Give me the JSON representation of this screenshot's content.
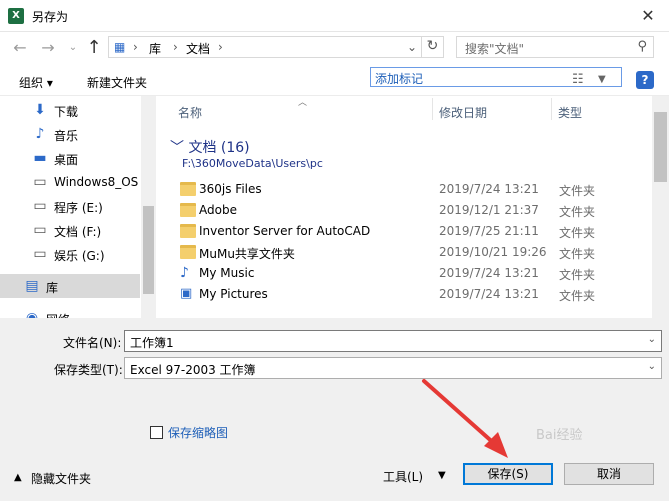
{
  "window": {
    "title": "另存为",
    "app_icon": "X",
    "close_icon": "✕"
  },
  "address": {
    "root_icon": "▦",
    "crumbs": [
      "库",
      "文档"
    ],
    "separator": "›"
  },
  "search": {
    "placeholder": "搜索\"文档\""
  },
  "toolbar": {
    "organize_label": "组织 ▾",
    "new_folder_label": "新建文件夹",
    "add_tag_label": "添加标记"
  },
  "sidebar": {
    "items": [
      {
        "label": "下载",
        "icon": "⬇",
        "color": "#2c69c8"
      },
      {
        "label": "音乐",
        "icon": "♪",
        "color": "#2c69c8"
      },
      {
        "label": "桌面",
        "icon": "▬",
        "color": "#2c69c8"
      },
      {
        "label": "Windows8_OS",
        "icon": "▭",
        "color": "#555555"
      },
      {
        "label": "程序 (E:)",
        "icon": "▭",
        "color": "#555555"
      },
      {
        "label": "文档 (F:)",
        "icon": "▭",
        "color": "#555555"
      },
      {
        "label": "娱乐 (G:)",
        "icon": "▭",
        "color": "#555555"
      },
      {
        "label": "库",
        "icon": "▤",
        "color": "#2c69c8"
      },
      {
        "label": "网络",
        "icon": "◉",
        "color": "#2c69c8"
      }
    ]
  },
  "columns": {
    "name": "名称",
    "date": "修改日期",
    "type": "类型"
  },
  "group": {
    "title": "文档 (16)",
    "path": "F:\\360MoveData\\Users\\pc"
  },
  "files": [
    {
      "name": "360js Files",
      "date": "2019/7/24 13:21",
      "type": "文件夹"
    },
    {
      "name": "Adobe",
      "date": "2019/12/1 21:37",
      "type": "文件夹"
    },
    {
      "name": "Inventor Server for AutoCAD",
      "date": "2019/7/25 21:11",
      "type": "文件夹"
    },
    {
      "name": "MuMu共享文件夹",
      "date": "2019/10/21 19:26",
      "type": "文件夹"
    },
    {
      "name": "My Music",
      "date": "2019/7/24 13:21",
      "type": "文件夹"
    },
    {
      "name": "My Pictures",
      "date": "2019/7/24 13:21",
      "type": "文件夹"
    }
  ],
  "form": {
    "filename_label": "文件名(N):",
    "filename_value": "工作簿1",
    "filetype_label": "保存类型(T):",
    "filetype_value": "Excel 97-2003 工作簿",
    "thumbnail_label": "保存缩略图"
  },
  "footer": {
    "hide_folders_label": "隐藏文件夹",
    "tools_label": "工具(L)",
    "save_label": "保存(S)",
    "cancel_label": "取消"
  },
  "watermark": "Bai经验",
  "colors": {
    "accent": "#0078d7",
    "arrow": "#e53935",
    "folder": "#f4cf6d"
  }
}
